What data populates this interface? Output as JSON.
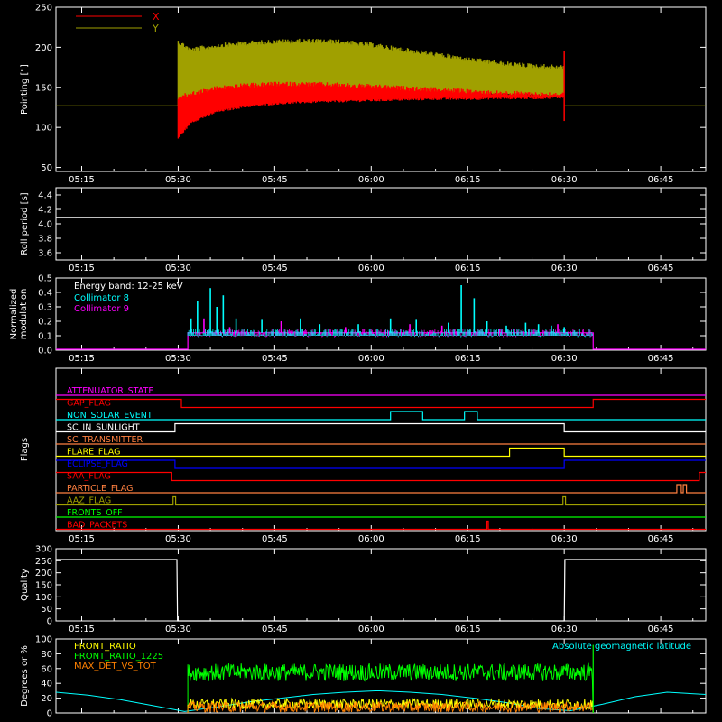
{
  "figure": {
    "background": "#000000",
    "foreground": "#ffffff"
  },
  "time_ticks": [
    "05:15",
    "05:30",
    "05:45",
    "06:00",
    "06:15",
    "06:30",
    "06:45"
  ],
  "time_minutes": [
    315,
    330,
    345,
    360,
    375,
    390,
    405
  ],
  "chart_data": [
    {
      "id": "pointing",
      "type": "line",
      "ylabel": "Pointing [\"]",
      "ylim": [
        45,
        250
      ],
      "yticks": [
        50,
        100,
        150,
        200,
        250
      ],
      "xlim": [
        311,
        412
      ],
      "legend_placement": "top-left",
      "series": [
        {
          "name": "X",
          "color": "#ff0000",
          "band_x": [
            330,
            332,
            336,
            340,
            345,
            350,
            355,
            360,
            365,
            370,
            375,
            380,
            385,
            390
          ],
          "band_lo": [
            85,
            105,
            118,
            124,
            128,
            130,
            131,
            132,
            133,
            134,
            134,
            135,
            135,
            136
          ],
          "band_hi": [
            140,
            145,
            152,
            155,
            157,
            157,
            156,
            154,
            152,
            150,
            148,
            146,
            145,
            144
          ]
        },
        {
          "name": "Y",
          "color": "#a0a000",
          "band_x": [
            330,
            332,
            336,
            340,
            345,
            350,
            355,
            360,
            365,
            370,
            375,
            380,
            385,
            390
          ],
          "band_lo": [
            125,
            128,
            132,
            135,
            138,
            140,
            141,
            142,
            142,
            142,
            141,
            140,
            139,
            138
          ],
          "band_hi": [
            210,
            200,
            205,
            208,
            210,
            211,
            210,
            206,
            200,
            194,
            188,
            183,
            180,
            178
          ]
        }
      ],
      "baseline": 127
    },
    {
      "id": "roll",
      "type": "line",
      "ylabel": "Roll period [s]",
      "ylim": [
        3.5,
        4.5
      ],
      "yticks": [
        3.6,
        3.8,
        4.0,
        4.2,
        4.4
      ],
      "xlim": [
        311,
        412
      ],
      "series": [
        {
          "x": [
            311,
            412
          ],
          "y": [
            4.09,
            4.09
          ],
          "color": "#ffffff"
        }
      ]
    },
    {
      "id": "modulation",
      "type": "line",
      "ylabel": "Normalized modulation",
      "ylim": [
        0,
        0.5
      ],
      "yticks": [
        0.0,
        0.1,
        0.2,
        0.3,
        0.4,
        0.5
      ],
      "xlim": [
        311,
        412
      ],
      "annotation": "Energy band: 12-25 keV",
      "series": [
        {
          "name": "Collimator 8",
          "color": "#00ffff",
          "spike_x": [
            332,
            333,
            335,
            336,
            337,
            339,
            343,
            349,
            352,
            358,
            363,
            367,
            372,
            374,
            376,
            378,
            381,
            384,
            386,
            388,
            390
          ],
          "spike_y": [
            0.22,
            0.34,
            0.43,
            0.3,
            0.38,
            0.22,
            0.21,
            0.22,
            0.18,
            0.18,
            0.22,
            0.21,
            0.19,
            0.45,
            0.36,
            0.2,
            0.17,
            0.19,
            0.18,
            0.17,
            0.16
          ]
        },
        {
          "name": "Collimator 9",
          "color": "#ff00ff",
          "spike_x": [
            334,
            338,
            346,
            356,
            366,
            371,
            380,
            389
          ],
          "spike_y": [
            0.22,
            0.16,
            0.2,
            0.16,
            0.18,
            0.17,
            0.15,
            0.18
          ]
        }
      ],
      "window": [
        331.5,
        394.5
      ],
      "level": 0.12
    },
    {
      "id": "flags",
      "type": "line",
      "ylabel": "Flags",
      "xlim": [
        311,
        412
      ],
      "series": [
        {
          "name": "ATTENUATOR_STATE",
          "color": "#ff00ff",
          "steps": [
            [
              311,
              0
            ]
          ]
        },
        {
          "name": "GAP_FLAG",
          "color": "#ff0000",
          "steps": [
            [
              311,
              1
            ],
            [
              330.5,
              0
            ],
            [
              394.5,
              1
            ]
          ]
        },
        {
          "name": "NON_SOLAR_EVENT",
          "color": "#00ffff",
          "steps": [
            [
              311,
              0
            ],
            [
              363,
              1
            ],
            [
              368,
              0
            ],
            [
              374.5,
              1
            ],
            [
              376.5,
              0
            ]
          ]
        },
        {
          "name": "SC_IN_SUNLIGHT",
          "color": "#ffffff",
          "steps": [
            [
              311,
              0
            ],
            [
              329.5,
              1
            ],
            [
              390,
              0
            ]
          ]
        },
        {
          "name": "SC_TRANSMITTER",
          "color": "#ff8040",
          "steps": [
            [
              311,
              0
            ]
          ]
        },
        {
          "name": "FLARE_FLAG",
          "color": "#ffff00",
          "steps": [
            [
              311,
              0
            ],
            [
              381.5,
              1
            ],
            [
              390,
              0
            ]
          ]
        },
        {
          "name": "ECLIPSE_FLAG",
          "color": "#0000ff",
          "steps": [
            [
              311,
              1
            ],
            [
              329.5,
              0
            ],
            [
              390,
              1
            ]
          ]
        },
        {
          "name": "SAA_FLAG",
          "color": "#ff0000",
          "steps": [
            [
              311,
              1
            ],
            [
              329,
              0
            ],
            [
              411,
              1
            ]
          ]
        },
        {
          "name": "PARTICLE_FLAG",
          "color": "#ff8040",
          "steps": [
            [
              311,
              0
            ],
            [
              407.5,
              1
            ],
            [
              408.2,
              0
            ],
            [
              408.5,
              1
            ],
            [
              409,
              0
            ]
          ]
        },
        {
          "name": "AAZ_FLAG",
          "color": "#a0a000",
          "steps": [
            [
              311,
              0
            ],
            [
              329.2,
              1
            ],
            [
              329.6,
              0
            ],
            [
              389.8,
              1
            ],
            [
              390.2,
              0
            ]
          ]
        },
        {
          "name": "FRONTS_OFF",
          "color": "#00ff00",
          "steps": [
            [
              311,
              0
            ]
          ]
        },
        {
          "name": "BAD_PACKETS",
          "color": "#ff0000",
          "steps": [
            [
              311,
              0
            ],
            [
              378,
              1
            ],
            [
              378.2,
              0
            ]
          ]
        }
      ]
    },
    {
      "id": "quality",
      "type": "line",
      "ylabel": "Quality",
      "ylim": [
        0,
        300
      ],
      "yticks": [
        0,
        50,
        100,
        150,
        200,
        250,
        300
      ],
      "xlim": [
        311,
        412
      ],
      "series": [
        {
          "x": [
            311,
            329.8,
            329.9,
            390.0,
            390.1,
            412
          ],
          "y": [
            255,
            255,
            0,
            0,
            255,
            255
          ],
          "color": "#ffffff"
        }
      ]
    },
    {
      "id": "ratios",
      "type": "line",
      "ylabel": "Degrees or %",
      "ylim": [
        0,
        100
      ],
      "yticks": [
        0,
        20,
        40,
        60,
        80,
        100
      ],
      "xlim": [
        311,
        412
      ],
      "series": [
        {
          "name": "FRONT_RATIO",
          "color": "#ffff00",
          "level": 12
        },
        {
          "name": "FRONT_RATIO_1225",
          "color": "#00ff00",
          "level": 55
        },
        {
          "name": "MAX_DET_VS_TOT",
          "color": "#ff8000",
          "level": 8
        },
        {
          "name": "Absolute geomagnetic latitude",
          "color": "#00ffff",
          "x": [
            311,
            316,
            321,
            326,
            331,
            336,
            341,
            346,
            351,
            356,
            361,
            366,
            371,
            376,
            381,
            386,
            391,
            396,
            401,
            406,
            412
          ],
          "y": [
            28,
            24,
            18,
            10,
            2,
            8,
            15,
            20,
            25,
            28,
            30,
            28,
            25,
            20,
            14,
            6,
            3,
            12,
            22,
            28,
            25
          ]
        }
      ],
      "window": [
        331.5,
        394.5
      ]
    }
  ]
}
